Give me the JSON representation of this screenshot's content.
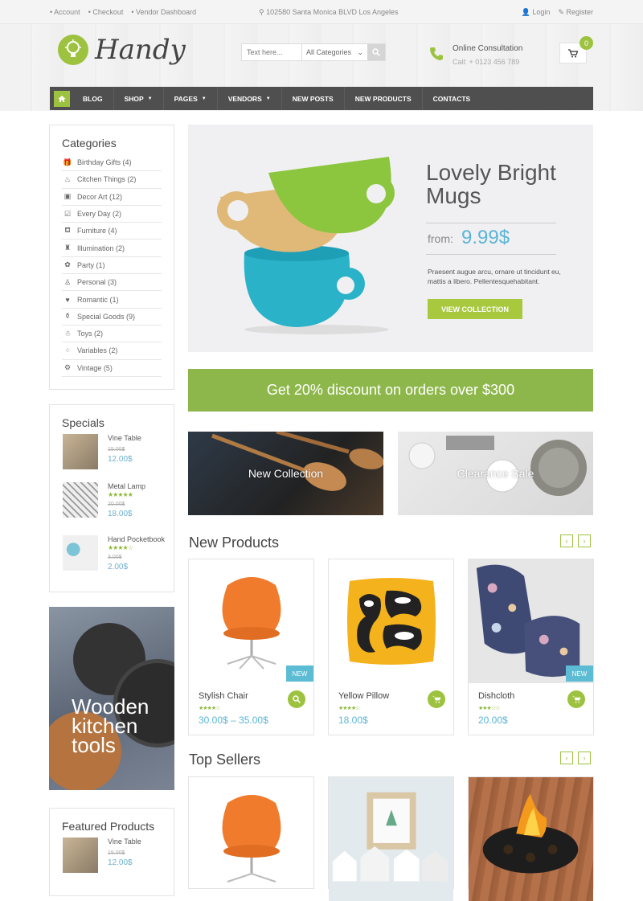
{
  "topbar": {
    "links": [
      "Account",
      "Checkout",
      "Vendor Dashboard"
    ],
    "address": "102580 Santa Monica BLVD Los Angeles",
    "login": "Login",
    "register": "Register"
  },
  "header": {
    "logo": "Handy",
    "search_placeholder": "Text here...",
    "category_select": "All Categories",
    "consult_title": "Online Consultation",
    "consult_phone": "Call: + 0123 456 789",
    "cart_count": "0"
  },
  "nav": {
    "items": [
      {
        "label": "BLOG",
        "caret": ""
      },
      {
        "label": "SHOP",
        "caret": "▼"
      },
      {
        "label": "PAGES",
        "caret": "▼"
      },
      {
        "label": "VENDORS",
        "caret": "▼"
      },
      {
        "label": "NEW POSTS",
        "caret": ""
      },
      {
        "label": "NEW PRODUCTS",
        "caret": ""
      },
      {
        "label": "CONTACTS",
        "caret": ""
      }
    ]
  },
  "categories": {
    "title": "Categories",
    "items": [
      "Birthday Gifts (4)",
      "Citchen Things (2)",
      "Decor Art (12)",
      "Every Day (2)",
      "Furniture (4)",
      "Illumination (2)",
      "Party (1)",
      "Personal (3)",
      "Romantic (1)",
      "Special Goods (9)",
      "Toys (2)",
      "Variables (2)",
      "Vintage (5)"
    ]
  },
  "specials": {
    "title": "Specials",
    "items": [
      {
        "name": "Vine Table",
        "old": "15.00$",
        "price": "12.00$",
        "rating": 0
      },
      {
        "name": "Metal Lamp",
        "old": "20.00$",
        "price": "18.00$",
        "rating": 5
      },
      {
        "name": "Hand Pocketbook",
        "old": "3.00$",
        "price": "2.00$",
        "rating": 4
      }
    ]
  },
  "promo": {
    "text": "Wooden\nkitchen\ntools"
  },
  "featured": {
    "title": "Featured Products",
    "items": [
      {
        "name": "Vine Table",
        "old": "15.00$",
        "price": "12.00$"
      }
    ]
  },
  "hero": {
    "title": "Lovely Bright\nMugs",
    "from": "from:",
    "price": "9.99$",
    "desc": "Praesent augue arcu, ornare ut tincidunt eu, mattis a libero. Pellentesquehabitant.",
    "button": "VIEW COLLECTION"
  },
  "discount": "Get 20% discount on orders over $300",
  "banners": [
    "New Collection",
    "Clearance Sale"
  ],
  "new_products": {
    "title": "New Products",
    "items": [
      {
        "name": "Stylish Chair",
        "price": "30.00$ – 35.00$",
        "tag": "NEW",
        "rating": 4
      },
      {
        "name": "Yellow Pillow",
        "price": "18.00$",
        "tag": "",
        "rating": 4
      },
      {
        "name": "Dishcloth",
        "price": "20.00$",
        "tag": "NEW",
        "rating": 3
      }
    ]
  },
  "top_sellers": {
    "title": "Top Sellers"
  },
  "arrows": {
    "prev": "‹",
    "next": "›"
  },
  "colors": {
    "accent": "#9dc23f",
    "price": "#5ab5d6",
    "nav": "#4f4f4f"
  }
}
